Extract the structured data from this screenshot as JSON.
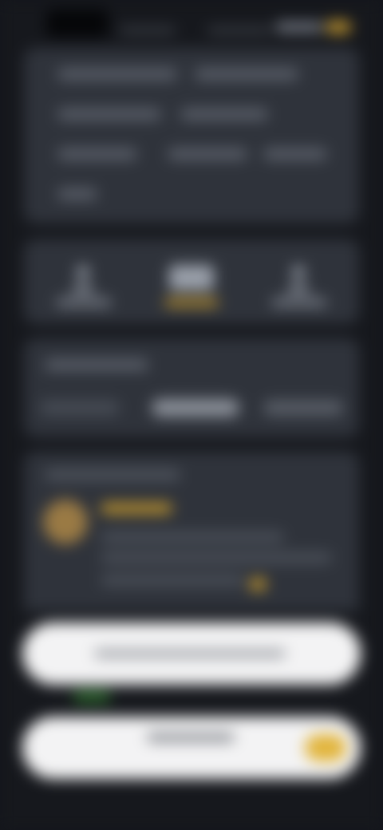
{
  "colors": {
    "background": "#16181d",
    "card": "#2f333b",
    "accent_gold": "#e2b53c",
    "pill": "#f3f3f4",
    "green": "#2e6a2e"
  },
  "status_bar": {
    "icons": [
      "signal-icon",
      "battery-icon"
    ]
  },
  "summary_card": {
    "rows": 4
  },
  "quick_actions": {
    "items": [
      {
        "icon": "person-icon"
      },
      {
        "icon": "card-icon"
      },
      {
        "icon": "person-icon"
      }
    ]
  },
  "segment_tabs": {
    "count": 3,
    "selected_index": 1
  },
  "notification": {
    "icons": [
      "coin-icon"
    ]
  },
  "buttons": {
    "primary": {},
    "secondary": {}
  }
}
